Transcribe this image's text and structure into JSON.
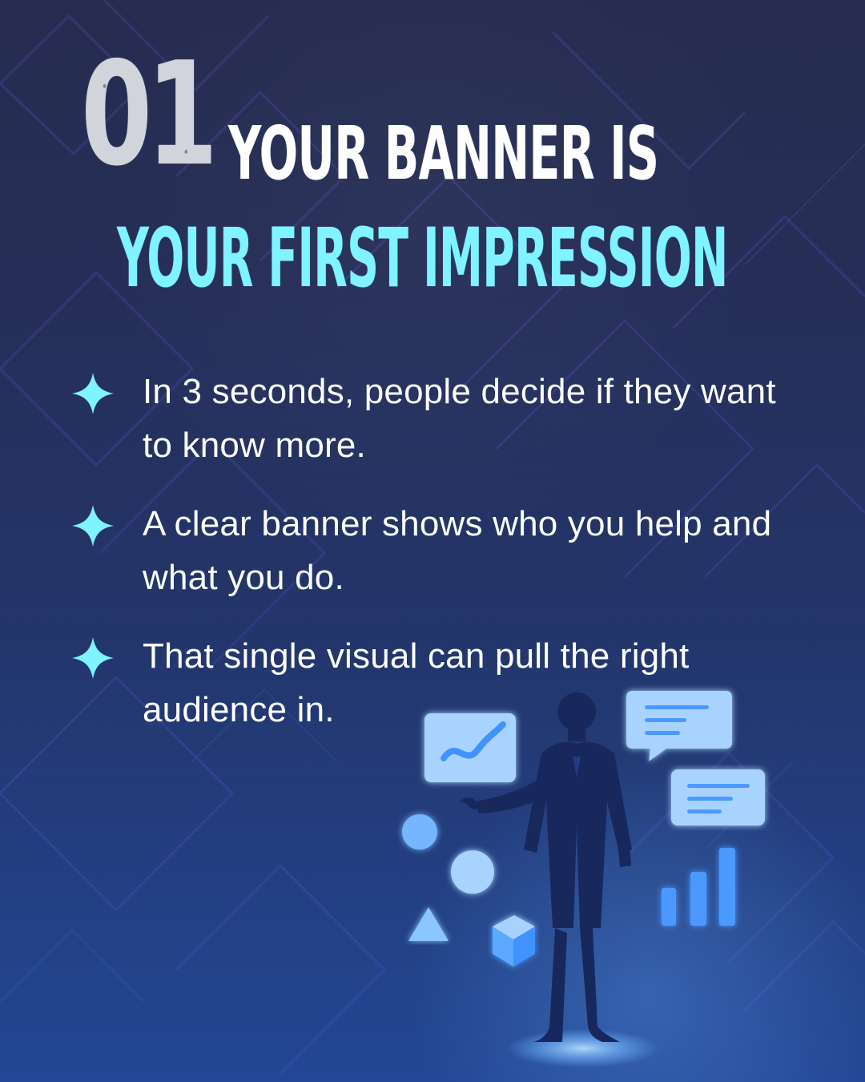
{
  "colors": {
    "background_top": "#22284c",
    "background_bottom": "#244a9a",
    "title_white": "#ffffff",
    "title_cyan": "#7ff3ff",
    "accent_blue": "#5ea8ff",
    "silhouette": "#18285d"
  },
  "header": {
    "number": "01",
    "line_1": "YOUR BANNER IS",
    "line_2": "YOUR FIRST IMPRESSION"
  },
  "bullets": [
    {
      "icon": "sparkle-icon",
      "text": "In 3 seconds, people decide if they want to know more."
    },
    {
      "icon": "sparkle-icon",
      "text": "A clear banner shows who you help and what you do."
    },
    {
      "icon": "sparkle-icon",
      "text": "That single visual can pull the right audience in."
    }
  ],
  "illustration": {
    "icons": [
      "line-chart-icon",
      "chat-bubble-icon",
      "message-card-icon",
      "bar-chart-icon",
      "circle-shape-icon",
      "triangle-shape-icon",
      "cube-shape-icon",
      "presenter-silhouette"
    ]
  }
}
